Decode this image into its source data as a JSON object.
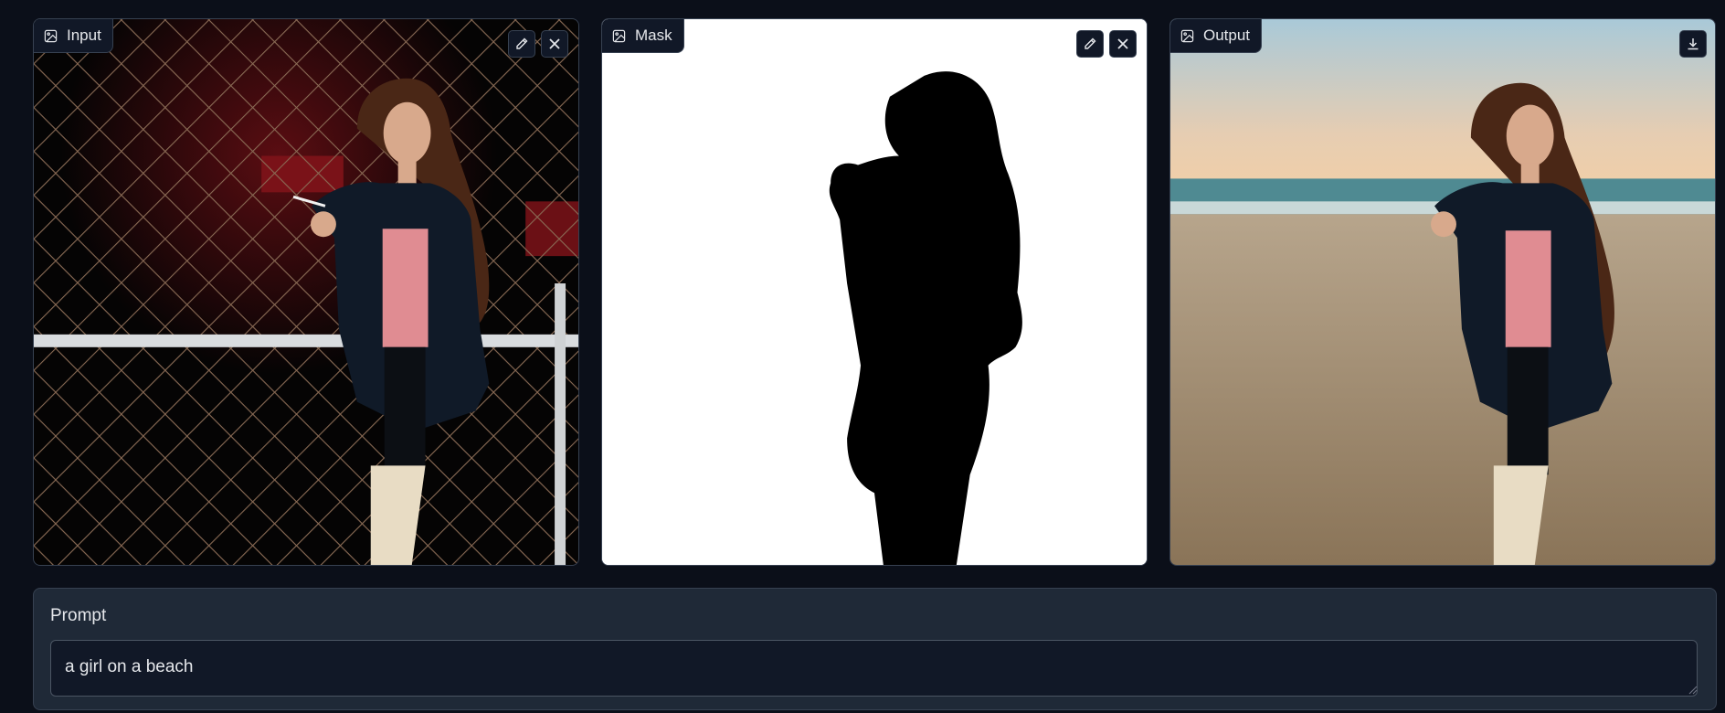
{
  "panels": {
    "input": {
      "label": "Input",
      "actions": [
        "pencil-icon",
        "close-icon"
      ]
    },
    "mask": {
      "label": "Mask",
      "actions": [
        "pencil-icon",
        "close-icon"
      ]
    },
    "output": {
      "label": "Output",
      "actions": [
        "download-icon"
      ]
    }
  },
  "prompt": {
    "label": "Prompt",
    "value": "a girl on a beach"
  },
  "colors": {
    "page_bg": "#0b0f19",
    "panel_bg": "#1f2937",
    "border": "#374151",
    "text": "#e5e7eb"
  }
}
